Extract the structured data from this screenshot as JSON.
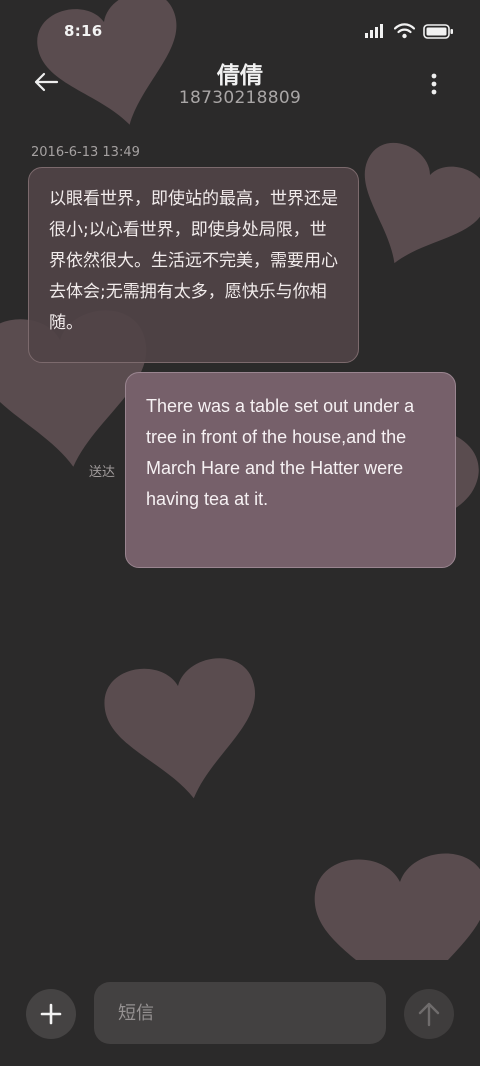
{
  "status_bar": {
    "time": "8:16",
    "icons": [
      "signal-icon",
      "wifi-icon",
      "battery-icon"
    ]
  },
  "header": {
    "contact_name": "倩倩",
    "contact_number": "18730218809",
    "back_icon": "back-arrow-icon",
    "more_icon": "more-vertical-icon"
  },
  "conversation": {
    "timestamp": "2016-6-13 13:49",
    "messages": [
      {
        "direction": "incoming",
        "text": "以眼看世界，即使站的最高，世界还是很小;以心看世界，即使身处局限，世界依然很大。生活远不完美，需要用心去体会;无需拥有太多，愿快乐与你相随。"
      },
      {
        "direction": "outgoing",
        "text": "There was a table set out under a tree in front of the house,and the March Hare and the Hatter were having tea at it.",
        "status": "送达"
      }
    ]
  },
  "composer": {
    "add_icon": "plus-icon",
    "placeholder": "短信",
    "value": "",
    "send_icon": "send-arrow-up-icon"
  },
  "theme": {
    "background": "#2b2a2a",
    "heart_color": "#5a4c4f",
    "incoming_bubble": "#504346",
    "outgoing_bubble": "#76606a"
  }
}
